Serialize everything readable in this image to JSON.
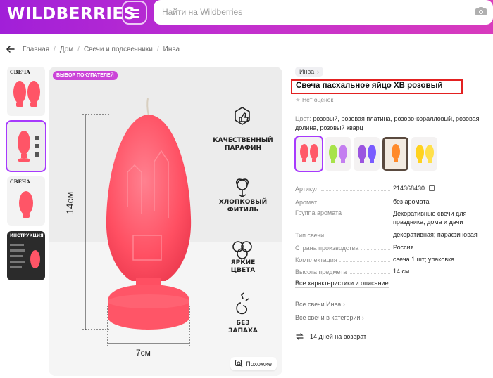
{
  "header": {
    "logo": "WILDBERRIES",
    "search_placeholder": "Найти на Wildberries",
    "icons": [
      "menu-icon",
      "camera-icon"
    ]
  },
  "breadcrumbs": [
    "Главная",
    "Дом",
    "Свечи и подсвечники",
    "Инва"
  ],
  "thumbnails": [
    {
      "caption": "СВЕЧА",
      "selected": false
    },
    {
      "caption": "",
      "selected": true
    },
    {
      "caption": "СВЕЧА",
      "selected": false
    },
    {
      "caption": "ИНСТРУКЦИЯ",
      "selected": false
    }
  ],
  "main_image": {
    "badge": "ВЫБОР ПОКУПАТЕЛЕЙ",
    "height_label": "14см",
    "width_label": "7см",
    "features": [
      {
        "line1": "КАЧЕСТВЕННЫЙ",
        "line2": "ПАРАФИН",
        "icon": "thumbs-up-icon"
      },
      {
        "line1": "ХЛОПКОВЫЙ",
        "line2": "ФИТИЛЬ",
        "icon": "cotton-icon"
      },
      {
        "line1": "ЯРКИЕ",
        "line2": "ЦВЕТА",
        "icon": "rings-icon"
      },
      {
        "line1": "БЕЗ",
        "line2": "ЗАПАХА",
        "icon": "no-smell-icon"
      }
    ],
    "similar_label": "Похожие"
  },
  "product": {
    "brand": "Инва",
    "title": "Свеча пасхальное яйцо ХВ розовый",
    "rating": "Нет оценок",
    "color_label": "Цвет:",
    "color_value": "розовый, розовая платина, розово-коралловый, розовая долина, розовый кварц",
    "swatches": [
      {
        "colors": [
          "#ff5a68",
          "#ff5a68"
        ],
        "selected": true
      },
      {
        "colors": [
          "#a8e34a",
          "#c47ff0"
        ],
        "selected": false
      },
      {
        "colors": [
          "#9b55e0",
          "#7a5cff"
        ],
        "selected": false
      },
      {
        "colors": [
          "#ff8a2a",
          "#ff8a2a"
        ],
        "selected": false
      },
      {
        "colors": [
          "#ffd21f",
          "#ffe04a"
        ],
        "selected": false
      }
    ],
    "specs": [
      {
        "key": "Артикул",
        "value": "214368430"
      },
      {
        "key": "Аромат",
        "value": "без аромата"
      },
      {
        "key": "Группа аромата",
        "value": "Декоративные свечи для праздника, дома и дачи"
      },
      {
        "key": "Тип свечи",
        "value": "декоративная; парафиновая"
      },
      {
        "key": "Страна производства",
        "value": "Россия"
      },
      {
        "key": "Комплектация",
        "value": "свеча 1 шт; упаковка"
      },
      {
        "key": "Высота предмета",
        "value": "14 см"
      }
    ],
    "all_specs": "Все характеристики и описание",
    "links": [
      "Все свечи Инва",
      "Все свечи в категории"
    ],
    "returns": "14 дней на возврат"
  },
  "colors": {
    "accent": "#a73afd",
    "highlight": "#e32121",
    "candle": "#ff4f62",
    "badge": "#cb44d8"
  }
}
